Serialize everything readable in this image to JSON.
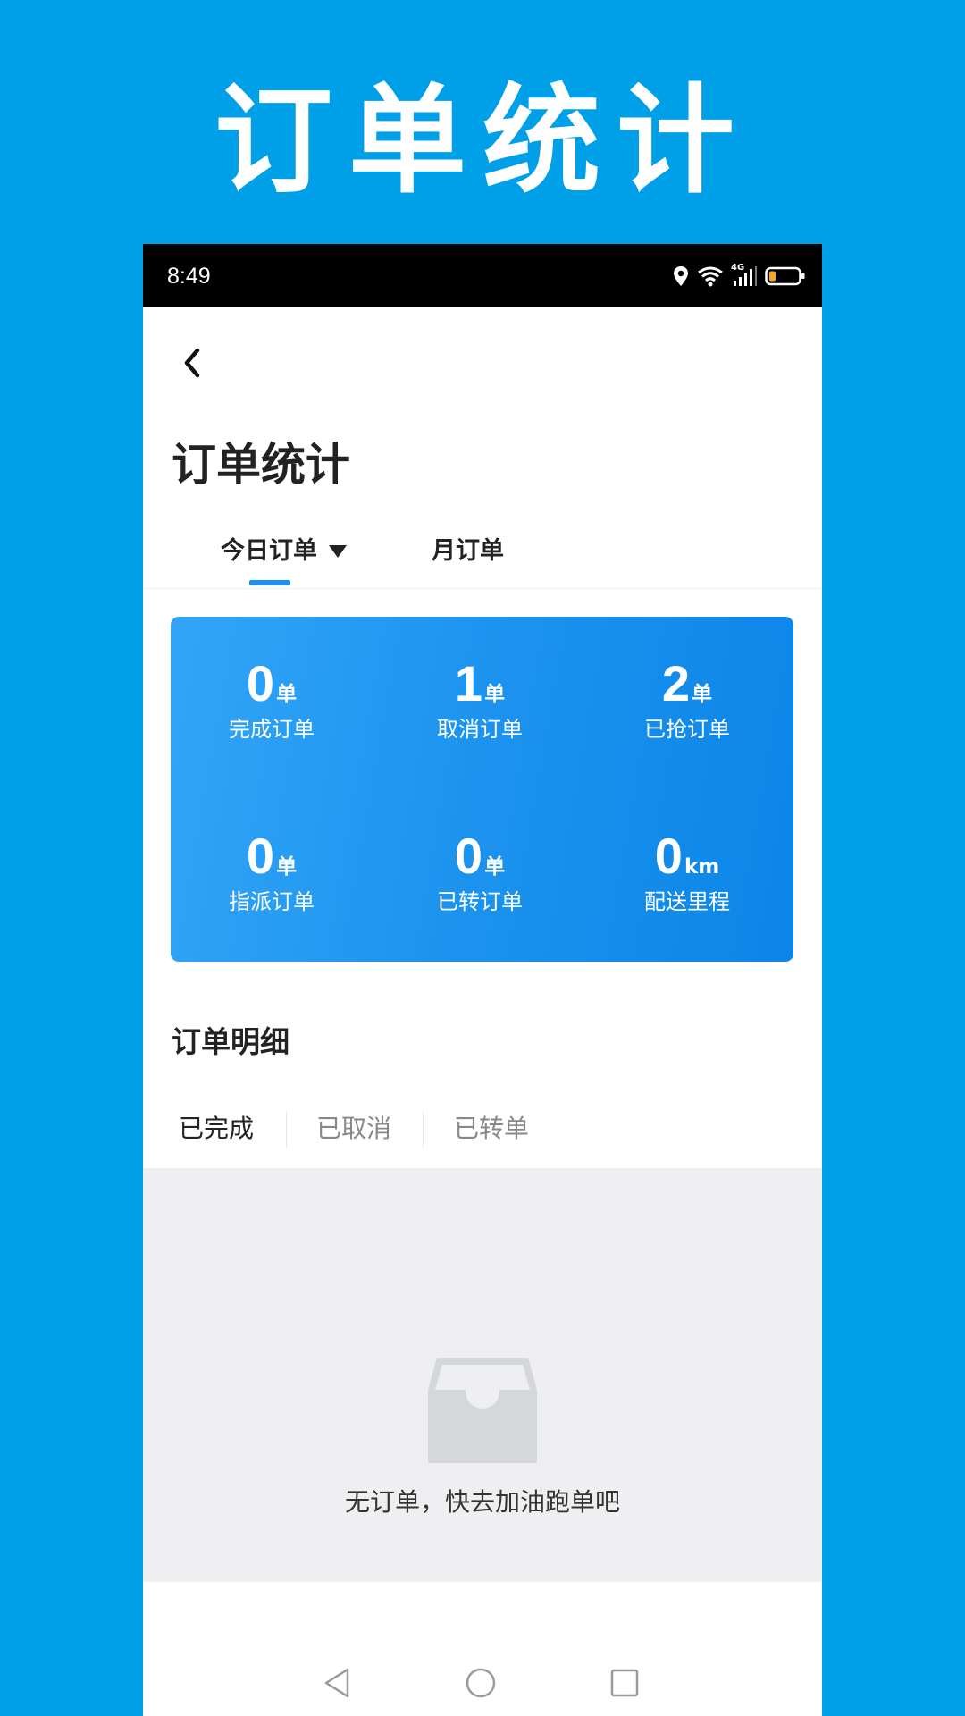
{
  "banner": {
    "title": "订单统计"
  },
  "status_bar": {
    "time": "8:49",
    "network": "4G"
  },
  "header": {
    "title": "订单统计"
  },
  "tabs": [
    {
      "label": "今日订单",
      "active": true
    },
    {
      "label": "月订单",
      "active": false
    }
  ],
  "stats": [
    {
      "value": "0",
      "unit": "单",
      "label": "完成订单"
    },
    {
      "value": "1",
      "unit": "单",
      "label": "取消订单"
    },
    {
      "value": "2",
      "unit": "单",
      "label": "已抢订单"
    },
    {
      "value": "0",
      "unit": "单",
      "label": "指派订单"
    },
    {
      "value": "0",
      "unit": "单",
      "label": "已转订单"
    },
    {
      "value": "0",
      "unit": "km",
      "label": "配送里程"
    }
  ],
  "detail": {
    "title": "订单明细",
    "filters": [
      "已完成",
      "已取消",
      "已转单"
    ],
    "empty_message": "无订单，快去加油跑单吧"
  },
  "colors": {
    "background": "#00a0e9",
    "accent": "#1e90f0",
    "card_gradient_start": "#32a5f7",
    "card_gradient_end": "#0b85e8",
    "battery_level": "#f5a623"
  },
  "icons": {
    "back": "chevron-left-icon",
    "dropdown": "triangle-down-icon",
    "empty": "empty-inbox-icon",
    "nav_back": "triangle-back-icon",
    "nav_home": "circle-home-icon",
    "nav_recent": "square-recent-icon"
  }
}
